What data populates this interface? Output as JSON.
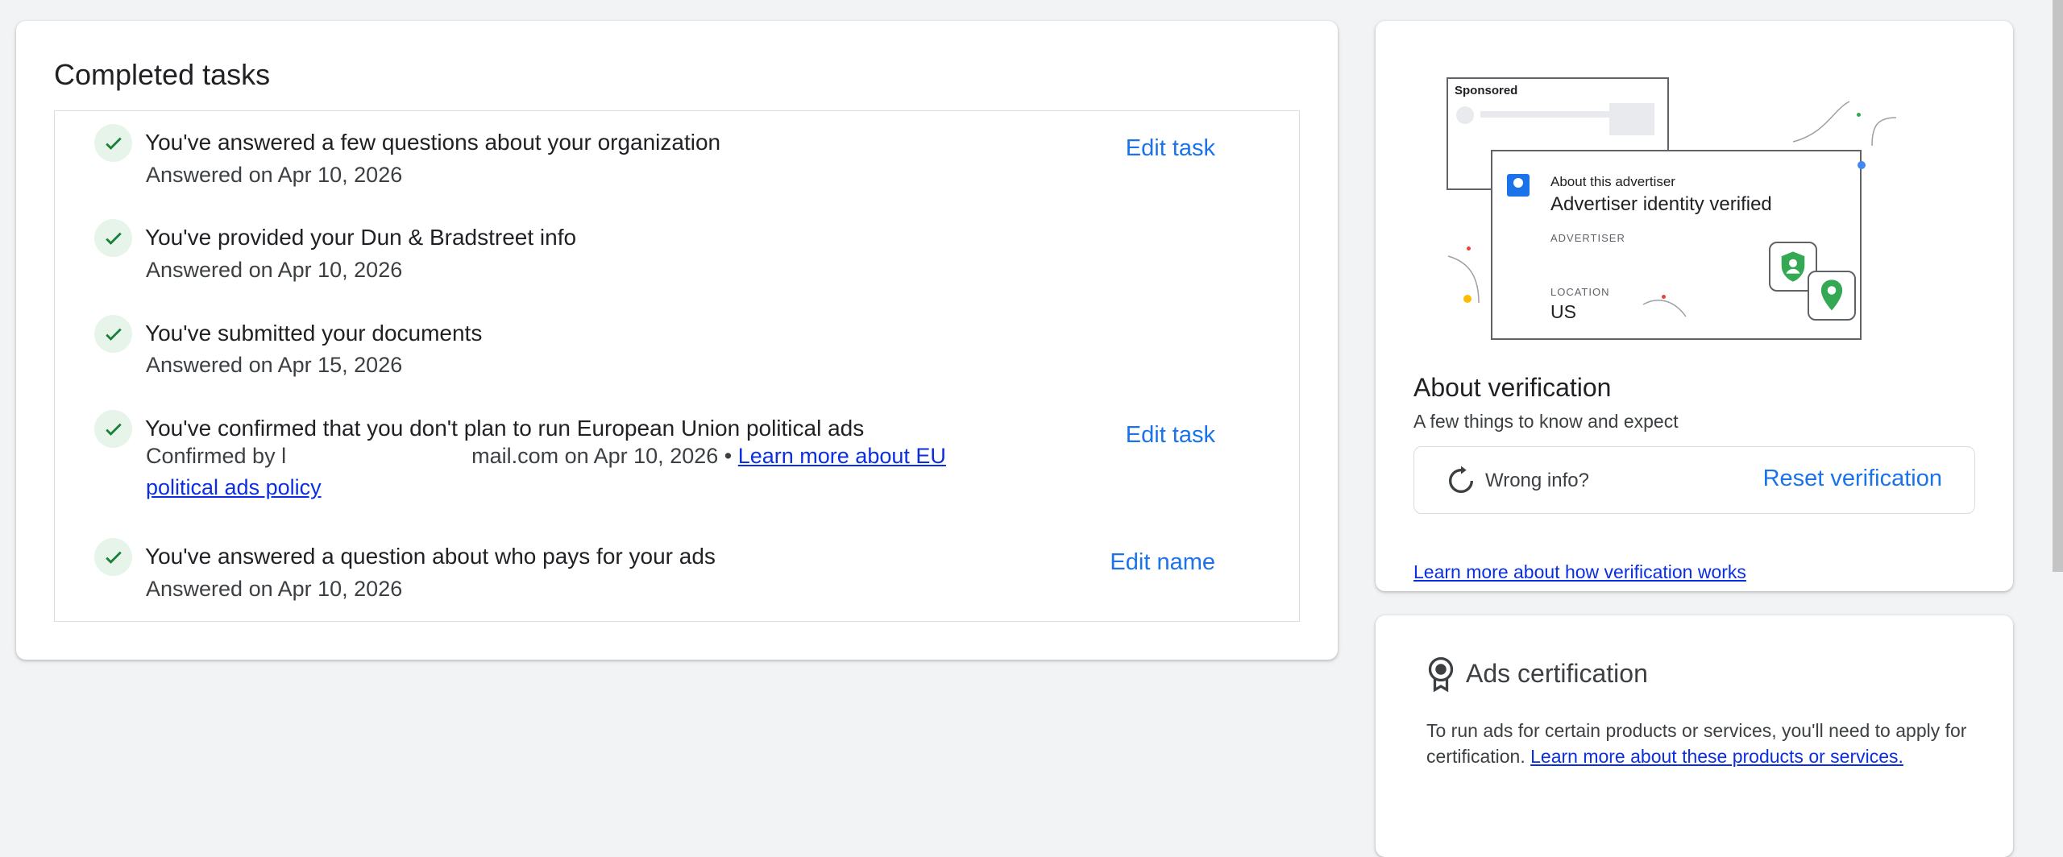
{
  "completed": {
    "title": "Completed tasks",
    "tasks": [
      {
        "title": "You've answered a few questions about your organization",
        "subtitle": "Answered on Apr 10, 2026",
        "action": "Edit task"
      },
      {
        "title": "You've provided your Dun & Bradstreet info",
        "subtitle": "Answered on Apr 10, 2026",
        "action": ""
      },
      {
        "title": "You've submitted your documents",
        "subtitle": "Answered on Apr 15, 2026",
        "action": ""
      },
      {
        "title": "You've confirmed that you don't plan to run European Union political ads",
        "subtitle_prefix": "Confirmed by l",
        "subtitle_email_tail": "mail.com on Apr 10, 2026 •",
        "link": "Learn more about EU political ads policy",
        "action": "Edit task"
      },
      {
        "title": "You've answered a question about who pays for your ads",
        "subtitle": "Answered on Apr 10, 2026",
        "action": "Edit name"
      }
    ]
  },
  "verification": {
    "illustration": {
      "sponsored": "Sponsored",
      "about_advertiser": "About this advertiser",
      "identity_verified": "Advertiser identity verified",
      "advertiser_label": "ADVERTISER",
      "location_label": "LOCATION",
      "location_value": "US"
    },
    "title": "About verification",
    "subtitle": "A few things to know and expect",
    "wrong_info": "Wrong info?",
    "reset_label": "Reset verification",
    "learn_more": "Learn more about how verification works"
  },
  "certification": {
    "title": "Ads certification",
    "text": "To run ads for certain products or services, you'll need to apply for certification.",
    "link": "Learn more about these products or services."
  },
  "colors": {
    "accent": "#1a73e8",
    "check_bg": "#e6f4ea",
    "check": "#188038",
    "link": "#0b2ee0"
  },
  "icons": {
    "task_status": "check-icon",
    "reset": "refresh-icon",
    "certification": "award-badge-icon"
  }
}
